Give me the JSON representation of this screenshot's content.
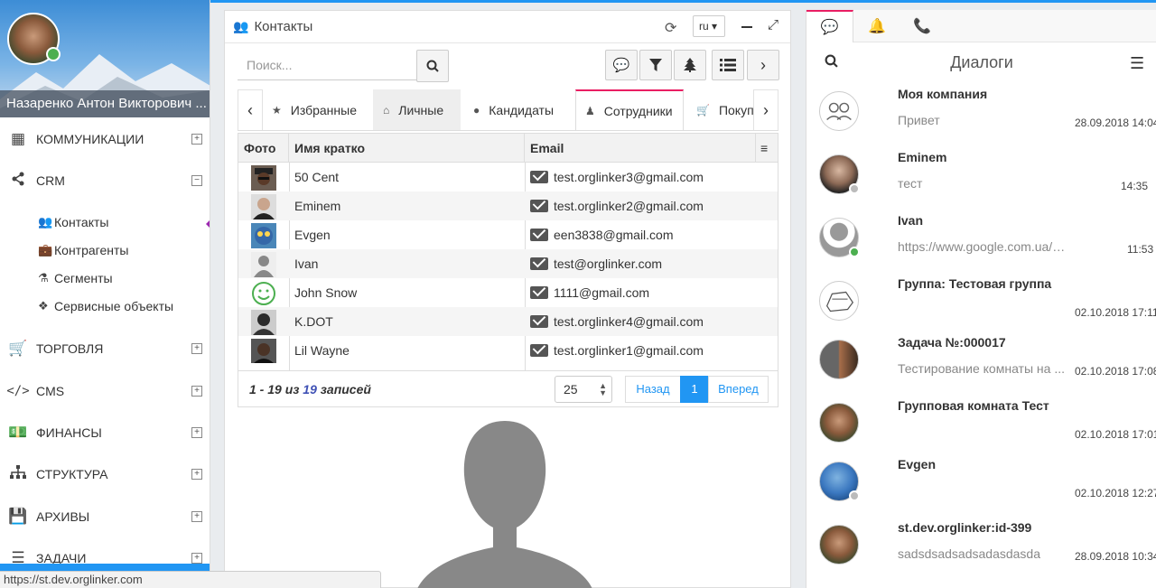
{
  "sidebar": {
    "user_name": "Назаренко Антон Викторович ...",
    "menu": [
      {
        "label": "КОММУНИКАЦИИ",
        "icon": "building-icon",
        "toggle": "+"
      },
      {
        "label": "CRM",
        "icon": "share-icon",
        "toggle": "−"
      },
      {
        "label": "ТОРГОВЛЯ",
        "icon": "cart-icon",
        "toggle": "+"
      },
      {
        "label": "CMS",
        "icon": "code-icon",
        "toggle": "+"
      },
      {
        "label": "ФИНАНСЫ",
        "icon": "money-icon",
        "toggle": "+"
      },
      {
        "label": "СТРУКТУРА",
        "icon": "sitemap-icon",
        "toggle": "+"
      },
      {
        "label": "АРХИВЫ",
        "icon": "save-icon",
        "toggle": "+"
      },
      {
        "label": "ЗАДАЧИ",
        "icon": "tasks-icon",
        "toggle": "+"
      }
    ],
    "crm_submenu": [
      {
        "label": "Контакты",
        "icon": "users-icon"
      },
      {
        "label": "Контрагенты",
        "icon": "briefcase-icon"
      },
      {
        "label": "Сегменты",
        "icon": "flask-icon"
      },
      {
        "label": "Сервисные объекты",
        "icon": "cubes-icon"
      }
    ]
  },
  "status_url": "https://st.dev.orglinker.com",
  "contacts": {
    "title": "Контакты",
    "lang": "ru",
    "search_placeholder": "Поиск...",
    "tabs": [
      {
        "label": "Избранные",
        "icon": "star-icon"
      },
      {
        "label": "Личные",
        "icon": "home-icon"
      },
      {
        "label": "Кандидаты",
        "icon": "candidate-icon"
      },
      {
        "label": "Сотрудники",
        "icon": "employee-icon"
      },
      {
        "label": "Покупа",
        "icon": "cart-icon"
      }
    ],
    "columns": {
      "photo": "Фото",
      "name": "Имя кратко",
      "email": "Email"
    },
    "rows": [
      {
        "name": "50 Cent",
        "email": "test.orglinker3@gmail.com"
      },
      {
        "name": "Eminem",
        "email": "test.orglinker2@gmail.com"
      },
      {
        "name": "Evgen",
        "email": "een3838@gmail.com"
      },
      {
        "name": "Ivan",
        "email": "test@orglinker.com"
      },
      {
        "name": "John Snow",
        "email": "1111@gmail.com"
      },
      {
        "name": "K.DOT",
        "email": "test.orglinker4@gmail.com"
      },
      {
        "name": "Lil Wayne",
        "email": "test.orglinker1@gmail.com"
      }
    ],
    "footer": {
      "range": "1 - 19",
      "of": "из",
      "total": "19",
      "suffix": "записей",
      "page_size": "25",
      "prev": "Назад",
      "page": "1",
      "next": "Вперед"
    }
  },
  "dialogs": {
    "title": "Диалоги",
    "items": [
      {
        "name": "Моя компания",
        "msg": "Привет",
        "time": "28.09.2018 14:04"
      },
      {
        "name": "Eminem",
        "msg": "тест",
        "time": "14:35"
      },
      {
        "name": "Ivan",
        "msg": "https://www.google.com.ua/url?sa=i&r...",
        "time": "11:53"
      },
      {
        "name": "Группа: Тестовая группа",
        "msg": "",
        "time": "02.10.2018 17:11"
      },
      {
        "name": "Задача №:000017",
        "msg": "Тестирование комнаты на ...",
        "time": "02.10.2018 17:08"
      },
      {
        "name": "Групповая комната Тест",
        "msg": "",
        "time": "02.10.2018 17:01"
      },
      {
        "name": "Evgen",
        "msg": "",
        "time": "02.10.2018 12:27"
      },
      {
        "name": "st.dev.orglinker:id-399",
        "msg": "sadsdsadsadsadasdasda",
        "time": "28.09.2018 10:34"
      }
    ]
  }
}
